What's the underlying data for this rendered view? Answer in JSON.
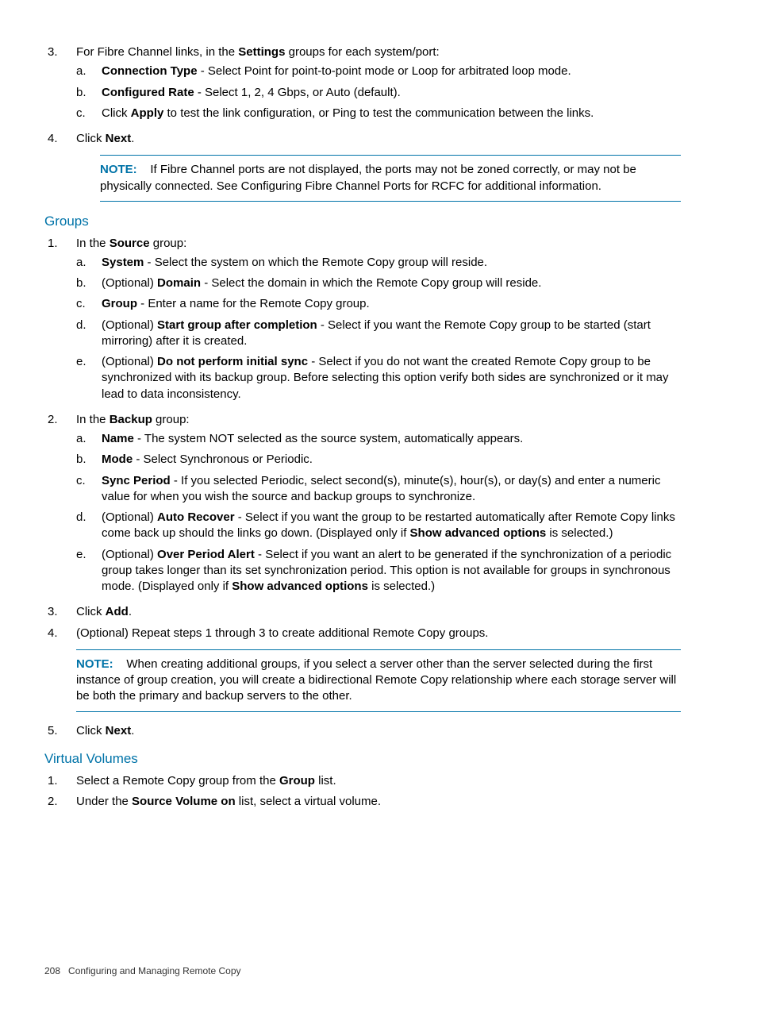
{
  "top": {
    "step3_lead_a": "For Fibre Channel links, in the ",
    "step3_bold": "Settings",
    "step3_lead_b": " groups for each system/port:",
    "a_bold": "Connection Type",
    "a_text": " - Select Point for point-to-point mode or Loop for arbitrated loop mode.",
    "b_bold": "Configured Rate",
    "b_text": " - Select 1, 2, 4 Gbps, or Auto (default).",
    "c_pre": "Click ",
    "c_bold": "Apply",
    "c_text": " to test the link configuration, or Ping to test the communication between the links.",
    "step4_a": "Click ",
    "step4_bold": "Next",
    "step4_b": ".",
    "note_label": "NOTE:",
    "note_text": "If Fibre Channel ports are not displayed, the ports may not be zoned correctly, or may not be physically connected. See Configuring Fibre Channel Ports for RCFC for additional information."
  },
  "groups": {
    "heading": "Groups",
    "src_lead_a": "In the ",
    "src_bold": "Source",
    "src_lead_b": " group:",
    "src_a_bold": "System",
    "src_a_text": " - Select the system on which the Remote Copy group will reside.",
    "src_b_pre": "(Optional) ",
    "src_b_bold": "Domain",
    "src_b_text": " - Select the domain in which the Remote Copy group will reside.",
    "src_c_bold": "Group",
    "src_c_text": " - Enter a name for the Remote Copy group.",
    "src_d_pre": "(Optional) ",
    "src_d_bold": "Start group after completion",
    "src_d_text": " - Select if you want the Remote Copy group to be started (start mirroring) after it is created.",
    "src_e_pre": "(Optional) ",
    "src_e_bold": "Do not perform initial sync",
    "src_e_text": " - Select if you do not want the created Remote Copy group to be synchronized with its backup group. Before selecting this option verify both sides are synchronized or it may lead to data inconsistency.",
    "bkp_lead_a": "In the ",
    "bkp_bold": "Backup",
    "bkp_lead_b": " group:",
    "bkp_a_bold": "Name",
    "bkp_a_text": " - The system NOT selected as the source system, automatically appears.",
    "bkp_b_bold": "Mode",
    "bkp_b_text": " - Select Synchronous or Periodic.",
    "bkp_c_bold": "Sync Period",
    "bkp_c_text": " - If you selected Periodic, select second(s), minute(s), hour(s), or day(s) and enter a numeric value for when you wish the source and backup groups to synchronize.",
    "bkp_d_pre": "(Optional) ",
    "bkp_d_bold": "Auto Recover",
    "bkp_d_text_a": " - Select if you want the group to be restarted automatically after Remote Copy links come back up should the links go down. (Displayed only if ",
    "bkp_d_bold2": "Show advanced options",
    "bkp_d_text_b": " is selected.)",
    "bkp_e_pre": "(Optional) ",
    "bkp_e_bold": "Over Period Alert",
    "bkp_e_text_a": " - Select if you want an alert to be generated if the synchronization of a periodic group takes longer than its set synchronization period. This option is not available for groups in synchronous mode. (Displayed only if ",
    "bkp_e_bold2": "Show advanced options",
    "bkp_e_text_b": " is selected.)",
    "step3_a": "Click ",
    "step3_bold": "Add",
    "step3_b": ".",
    "step4": "(Optional) Repeat steps 1 through 3 to create additional Remote Copy groups.",
    "note_label": "NOTE:",
    "note_text": "When creating additional groups, if you select a server other than the server selected during the first instance of group creation, you will create a bidirectional Remote Copy relationship where each storage server will be both the primary and backup servers to the other.",
    "step5_a": "Click ",
    "step5_bold": "Next",
    "step5_b": "."
  },
  "vv": {
    "heading": "Virtual Volumes",
    "step1_a": "Select a Remote Copy group from the ",
    "step1_bold": "Group",
    "step1_b": " list.",
    "step2_a": "Under the ",
    "step2_bold": "Source Volume on",
    "step2_b": " list, select a virtual volume."
  },
  "footer": {
    "page": "208",
    "title": "Configuring and Managing Remote Copy"
  }
}
